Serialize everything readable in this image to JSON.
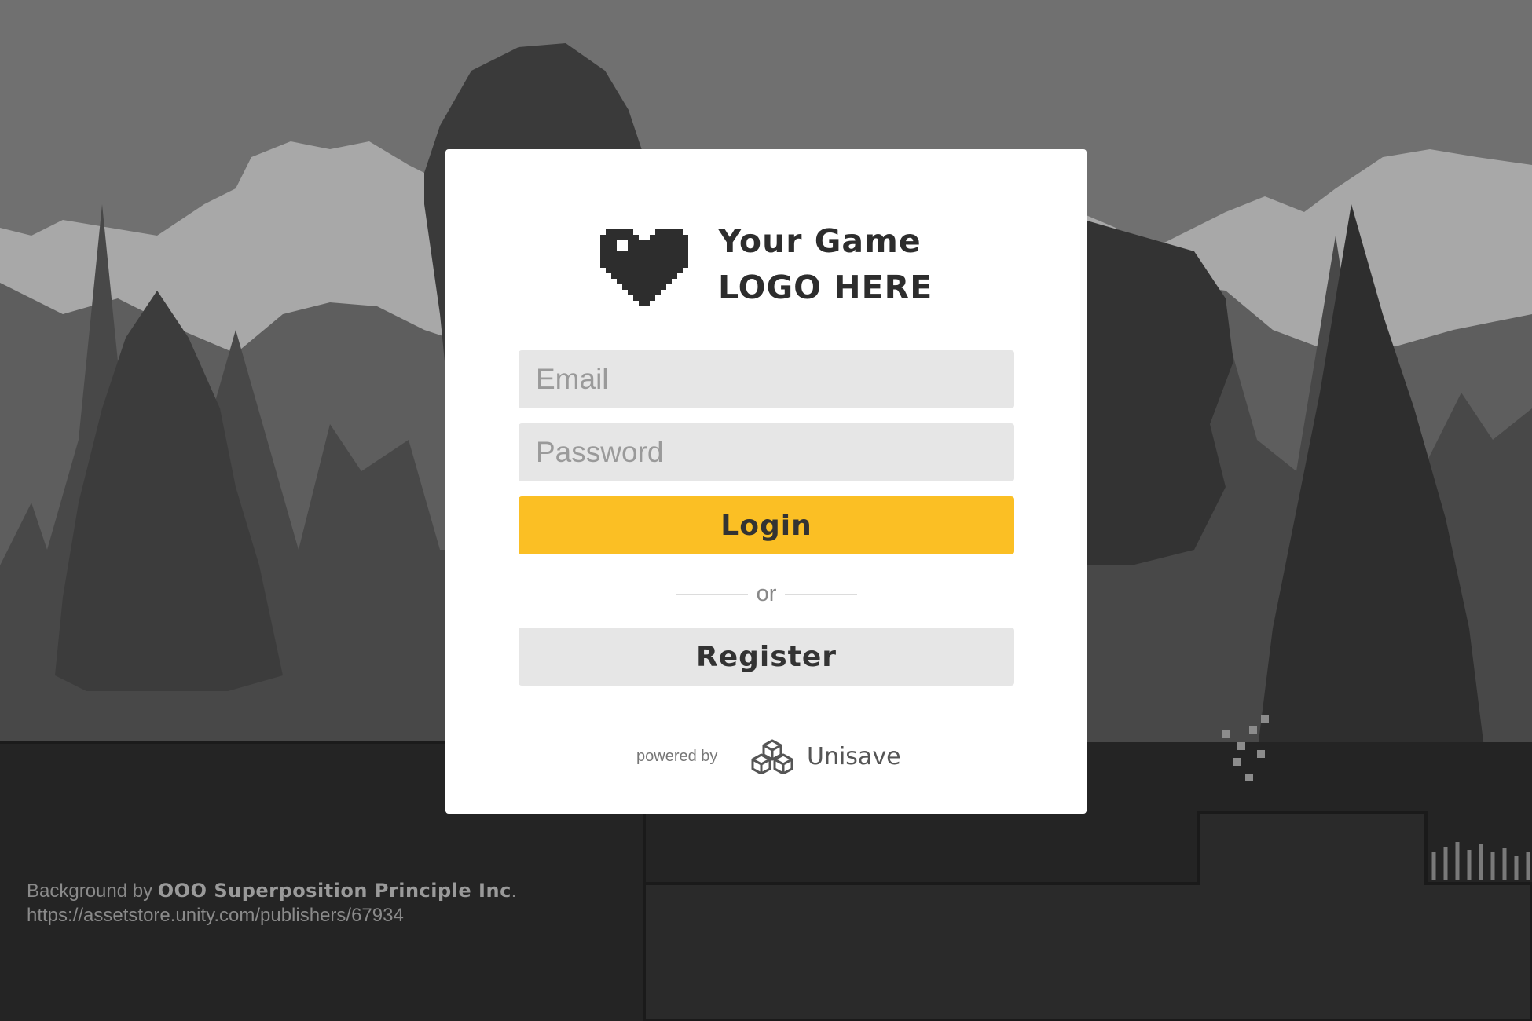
{
  "logo": {
    "icon": "pixel-heart-icon",
    "line1": "Your Game",
    "line2": "LOGO HERE"
  },
  "form": {
    "email_placeholder": "Email",
    "email_value": "",
    "password_placeholder": "Password",
    "password_value": "",
    "login_label": "Login",
    "divider_text": "or",
    "register_label": "Register"
  },
  "powered": {
    "label": "powered by",
    "brand": "Unisave",
    "icon": "unisave-cubes-icon"
  },
  "credits": {
    "prefix": "Background by",
    "author": "OOO Superposition Principle Inc",
    "suffix": ".",
    "url": "https://assetstore.unity.com/publishers/67934"
  },
  "colors": {
    "login_button": "#fbbf24",
    "input_background": "#e6e6e6",
    "page_background": "#242424"
  }
}
